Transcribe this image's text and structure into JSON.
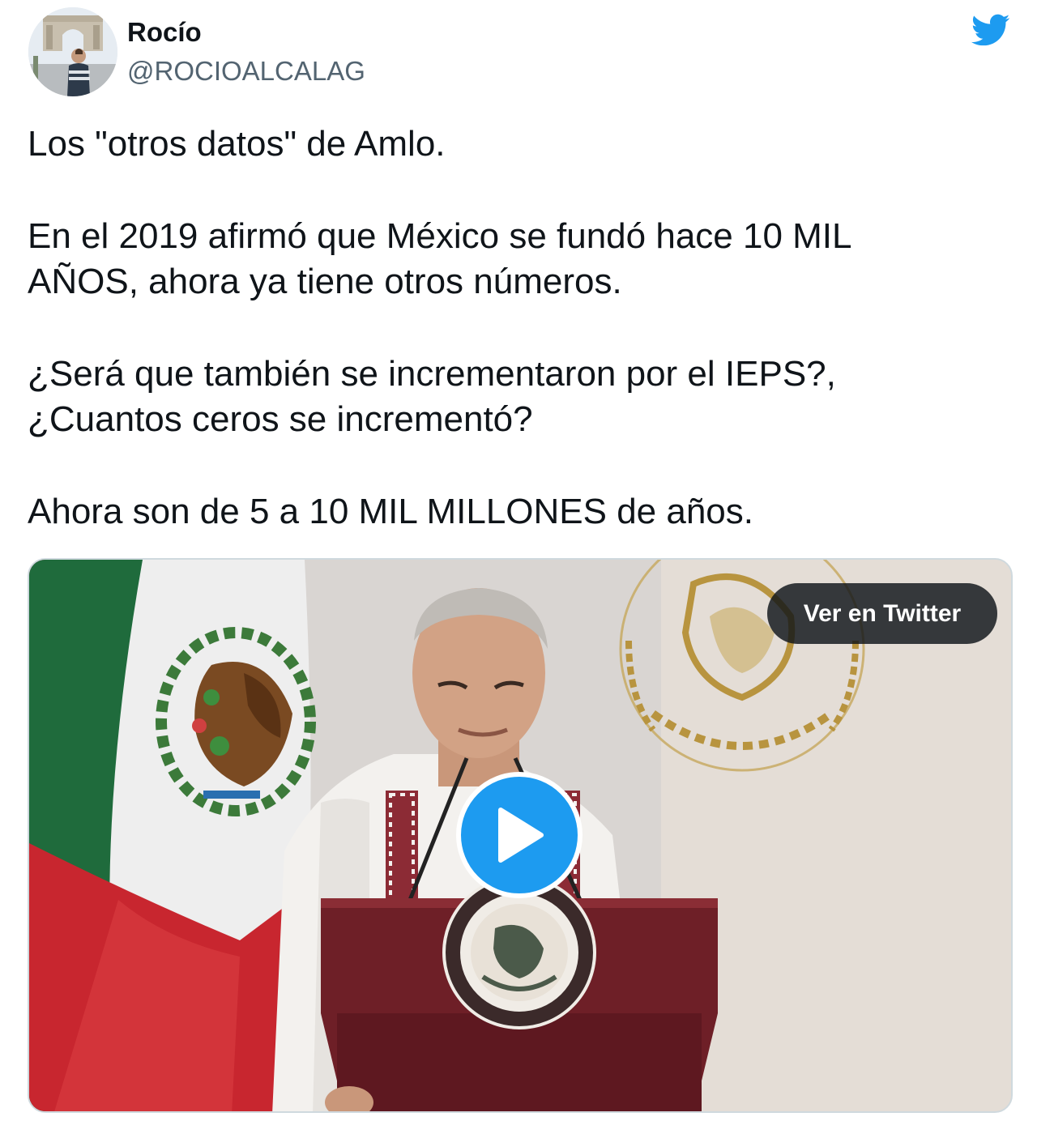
{
  "author": {
    "name": "Rocío",
    "handle": "@ROCIOALCALAG"
  },
  "icons": {
    "brand": "twitter-bird-icon",
    "play": "play-icon"
  },
  "colors": {
    "brand_blue": "#1d9bf0",
    "text_primary": "#0f1419",
    "text_secondary": "#536471"
  },
  "tweet": {
    "lines": [
      "Los \"otros datos\" de Amlo.",
      "En el 2019 afirmó que México se fundó hace 10 MIL",
      "AÑOS, ahora ya tiene otros números.",
      "¿Será que también se incrementaron por el IEPS?,",
      "¿Cuantos ceros se incrementó?",
      "Ahora son de 5 a 10 MIL MILLONES de años."
    ]
  },
  "media": {
    "type": "video",
    "view_button_label": "Ver en Twitter"
  }
}
